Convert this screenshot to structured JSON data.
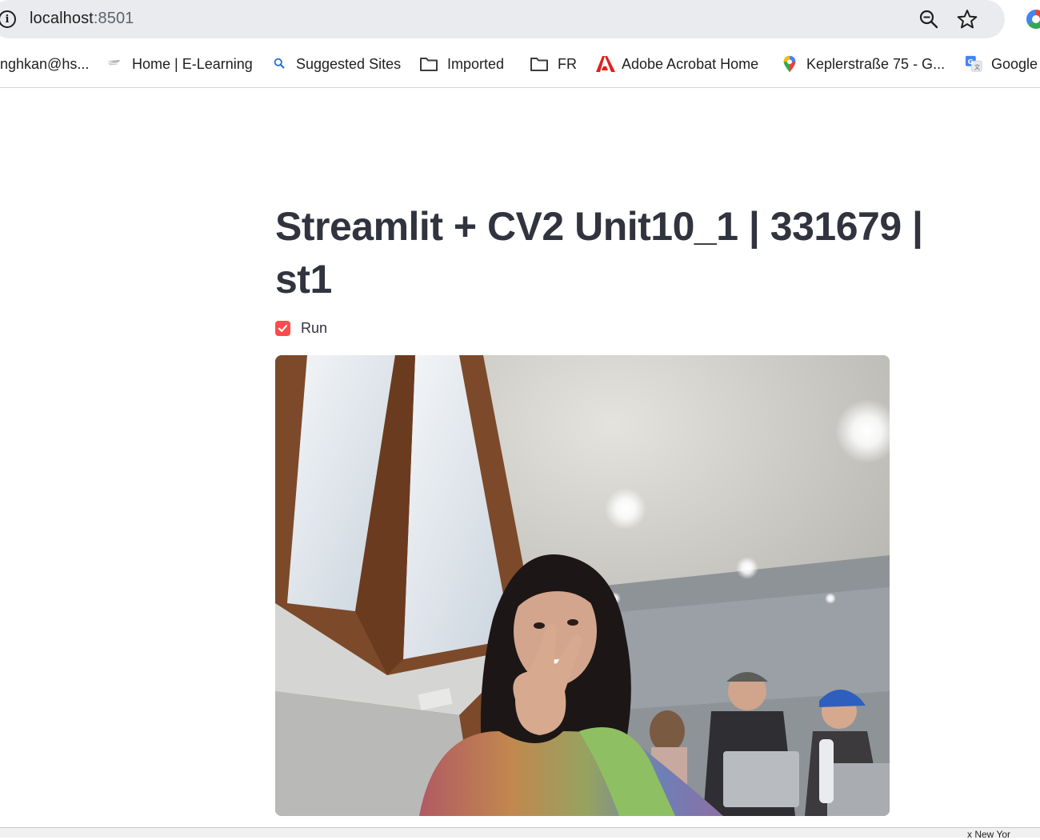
{
  "browser": {
    "url_host": "localhost",
    "url_port": ":8501",
    "bookmarks": [
      {
        "label": "nghkan@hs...",
        "icon": "mail-icon"
      },
      {
        "label": "Home | E-Learning",
        "icon": "elearning-icon"
      },
      {
        "label": "Suggested Sites",
        "icon": "search-icon"
      },
      {
        "label": "Imported",
        "icon": "folder-icon"
      },
      {
        "label": "FR",
        "icon": "folder-icon"
      },
      {
        "label": "Adobe Acrobat Home",
        "icon": "adobe-acrobat-icon"
      },
      {
        "label": "Keplerstraße 75 - G...",
        "icon": "maps-pin-icon"
      },
      {
        "label": "Google",
        "icon": "google-translate-icon"
      }
    ]
  },
  "app": {
    "title": "Streamlit + CV2 Unit10_1 | 331679 | st1",
    "checkbox": {
      "label": "Run",
      "checked": true
    },
    "accent_color": "#ff4b4b"
  },
  "statusbar": {
    "text": "x New Yor"
  }
}
